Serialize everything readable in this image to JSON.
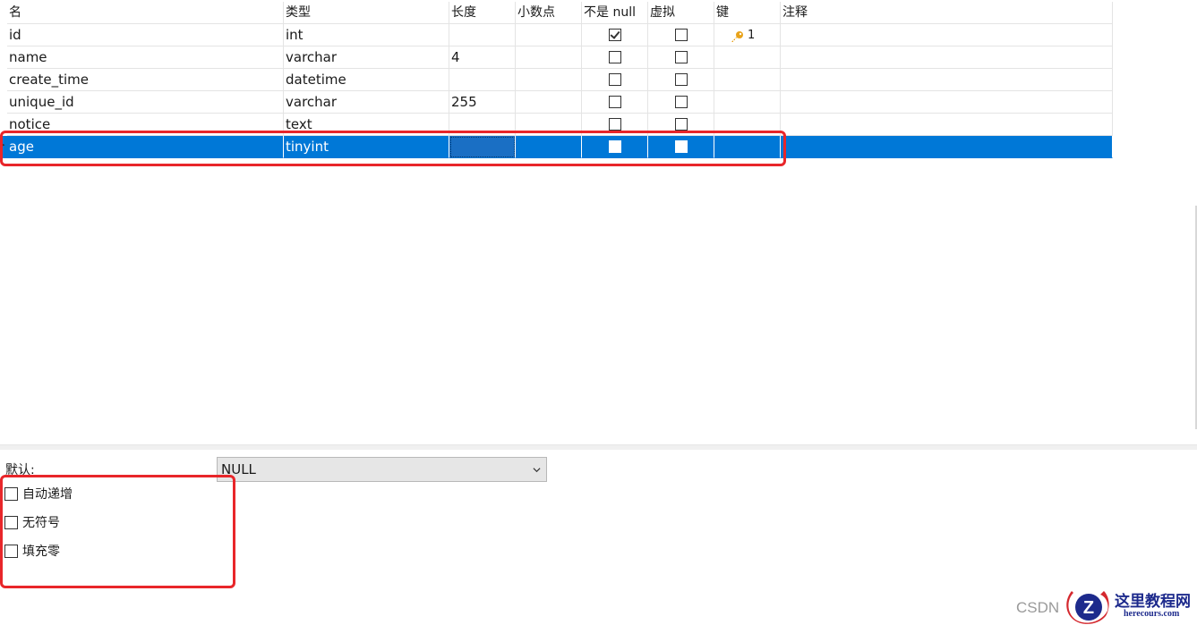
{
  "columns": [
    "名",
    "类型",
    "长度",
    "小数点",
    "不是 null",
    "虚拟",
    "键",
    "注释"
  ],
  "fields": [
    {
      "name": "id",
      "type": "int",
      "length": "",
      "decimals": "",
      "not_null": true,
      "virtual": false,
      "key": "1",
      "comment": ""
    },
    {
      "name": "name",
      "type": "varchar",
      "length": "4",
      "decimals": "",
      "not_null": false,
      "virtual": false,
      "key": "",
      "comment": ""
    },
    {
      "name": "create_time",
      "type": "datetime",
      "length": "",
      "decimals": "",
      "not_null": false,
      "virtual": false,
      "key": "",
      "comment": ""
    },
    {
      "name": "unique_id",
      "type": "varchar",
      "length": "255",
      "decimals": "",
      "not_null": false,
      "virtual": false,
      "key": "",
      "comment": ""
    },
    {
      "name": "notice",
      "type": "text",
      "length": "",
      "decimals": "",
      "not_null": false,
      "virtual": false,
      "key": "",
      "comment": ""
    },
    {
      "name": "age",
      "type": "tinyint",
      "length": "",
      "decimals": "",
      "not_null": false,
      "virtual": false,
      "key": "",
      "comment": "",
      "selected": true
    }
  ],
  "properties": {
    "default_label": "默认:",
    "default_value": "NULL",
    "options": [
      {
        "label": "自动递增",
        "checked": false
      },
      {
        "label": "无符号",
        "checked": false
      },
      {
        "label": "填充零",
        "checked": false
      }
    ]
  },
  "watermark": {
    "csdn": "CSDN",
    "brand_name": "这里教程网",
    "brand_url": "herecours.com"
  },
  "colors": {
    "selection": "#0078d7",
    "highlight_frame": "#e8262a",
    "key_icon": "#e8a31a",
    "brand": "#1d2a8c"
  }
}
